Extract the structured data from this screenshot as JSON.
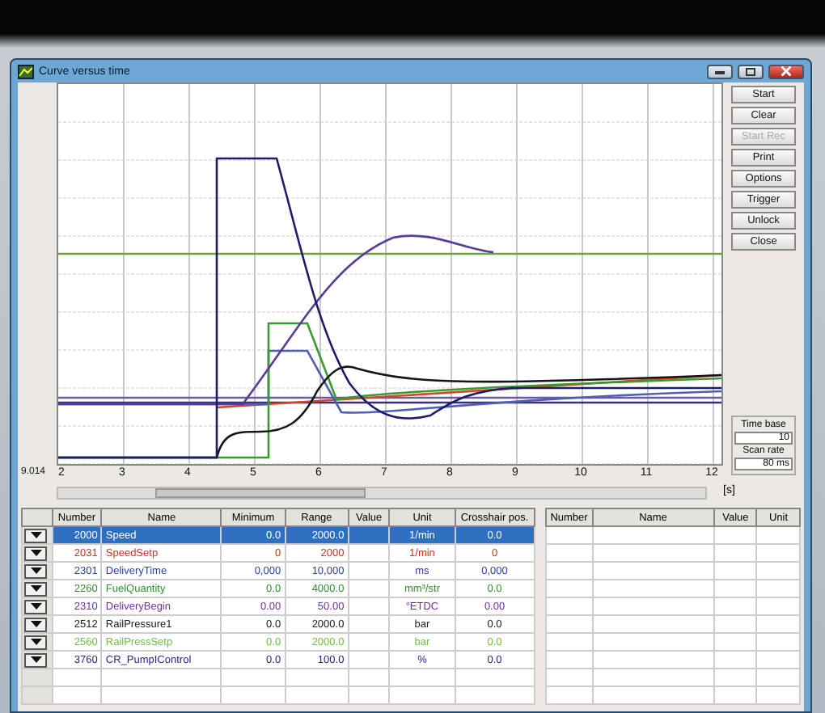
{
  "window": {
    "title": "Curve versus time"
  },
  "plot": {
    "x_start": "9.014",
    "x_ticks": [
      "2",
      "3",
      "4",
      "5",
      "6",
      "7",
      "8",
      "9",
      "10",
      "11",
      "12"
    ],
    "x_unit": "[s]"
  },
  "buttons": [
    {
      "label": "Start",
      "disabled": false
    },
    {
      "label": "Clear",
      "disabled": false
    },
    {
      "label": "Start Rec",
      "disabled": true
    },
    {
      "label": "Print",
      "disabled": false
    },
    {
      "label": "Options",
      "disabled": false
    },
    {
      "label": "Trigger",
      "disabled": false
    },
    {
      "label": "Unlock",
      "disabled": false
    },
    {
      "label": "Close",
      "disabled": false
    }
  ],
  "time_base": {
    "label": "Time base",
    "value": "10"
  },
  "scan_rate": {
    "label": "Scan rate",
    "value": "80 ms"
  },
  "signal_table": {
    "columns": [
      "Number",
      "Name",
      "Minimum",
      "Range",
      "Value",
      "Unit",
      "Crosshair pos."
    ],
    "rows": [
      {
        "number": "2000",
        "name": "Speed",
        "minimum": "0.0",
        "range": "2000.0",
        "unit": "1/min",
        "crosshair": "0.0",
        "selected": true
      },
      {
        "number": "2031",
        "name": "SpeedSetp",
        "minimum": "0",
        "range": "2000",
        "unit": "1/min",
        "crosshair": "0",
        "color": "#d03020",
        "selected": false
      },
      {
        "number": "2301",
        "name": "DeliveryTime",
        "minimum": "0,000",
        "range": "10,000",
        "unit": "ms",
        "crosshair": "0,000",
        "color": "#3040a8",
        "selected": false
      },
      {
        "number": "2260",
        "name": "FuelQuantity",
        "minimum": "0.0",
        "range": "4000.0",
        "unit": "mm³/str",
        "crosshair": "0.0",
        "color": "#309030",
        "selected": false
      },
      {
        "number": "2310",
        "name": "DeliveryBegin",
        "minimum": "0.00",
        "range": "50.00",
        "unit": "°ETDC",
        "crosshair": "0.00",
        "color": "#7030a0",
        "selected": false
      },
      {
        "number": "2512",
        "name": "RailPressure1",
        "minimum": "0.0",
        "range": "2000.0",
        "unit": "bar",
        "crosshair": "0.0",
        "color": "#202020",
        "selected": false
      },
      {
        "number": "2560",
        "name": "RailPressSetp",
        "minimum": "0.0",
        "range": "2000.0",
        "unit": "bar",
        "crosshair": "0.0",
        "color": "#70c040",
        "selected": false
      },
      {
        "number": "3760",
        "name": "CR_PumpIControl",
        "minimum": "0.0",
        "range": "100.0",
        "unit": "%",
        "crosshair": "0.0",
        "color": "#202880",
        "selected": false
      }
    ]
  },
  "value_table": {
    "columns": [
      "Number",
      "Name",
      "Value",
      "Unit"
    ]
  }
}
